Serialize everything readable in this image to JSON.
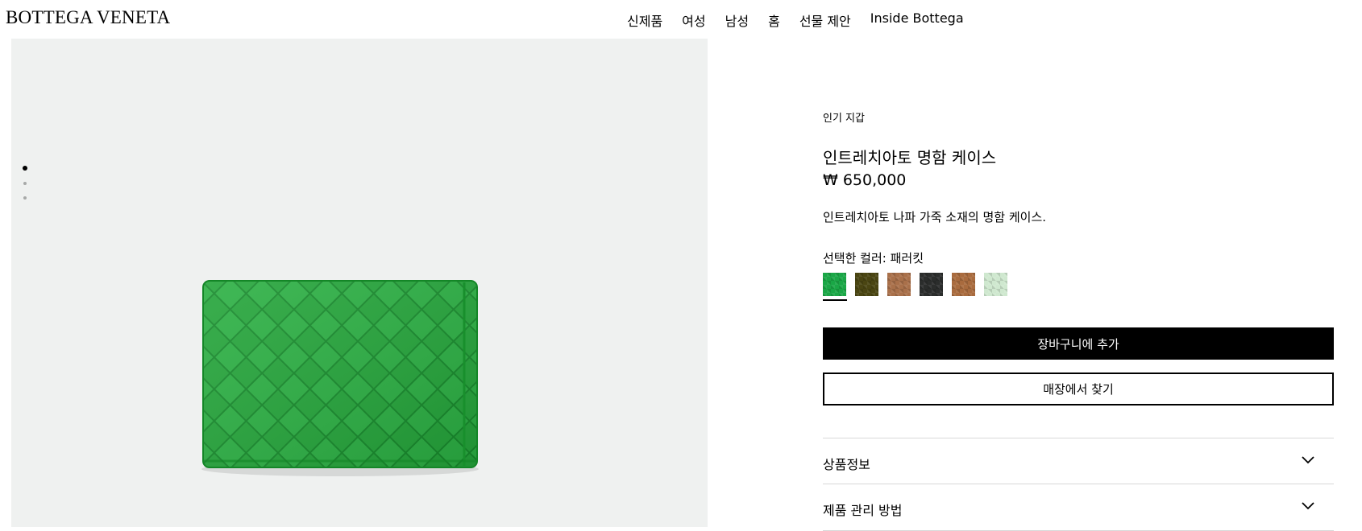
{
  "header": {
    "logo": "BOTTEGA VENETA",
    "nav": [
      "신제품",
      "여성",
      "남성",
      "홈",
      "선물 제안",
      "Inside Bottega"
    ]
  },
  "gallery": {
    "dots": 3,
    "active_index": 0
  },
  "product": {
    "category": "인기 지갑",
    "title": "인트레치아토 명함 케이스",
    "price": "₩ 650,000",
    "description": "인트레치아토 나파 가죽 소재의 명함 케이스.",
    "color_label": "선택한 컬러: 패러킷",
    "swatches": [
      {
        "color": "#1aa746",
        "selected": true
      },
      {
        "color": "#4a4512",
        "selected": false
      },
      {
        "color": "#a9704a",
        "selected": false
      },
      {
        "color": "#2b2d2c",
        "selected": false
      },
      {
        "color": "#a96b3e",
        "selected": false
      },
      {
        "color": "#cfe8cf",
        "selected": false
      }
    ],
    "add_to_cart_label": "장바구니에 추가",
    "find_in_store_label": "매장에서 찾기",
    "accordions": [
      "상품정보",
      "제품 관리 방법"
    ]
  },
  "colors": {
    "gallery_bg": "#eff1f0",
    "wallet_green": "#23a33a"
  }
}
